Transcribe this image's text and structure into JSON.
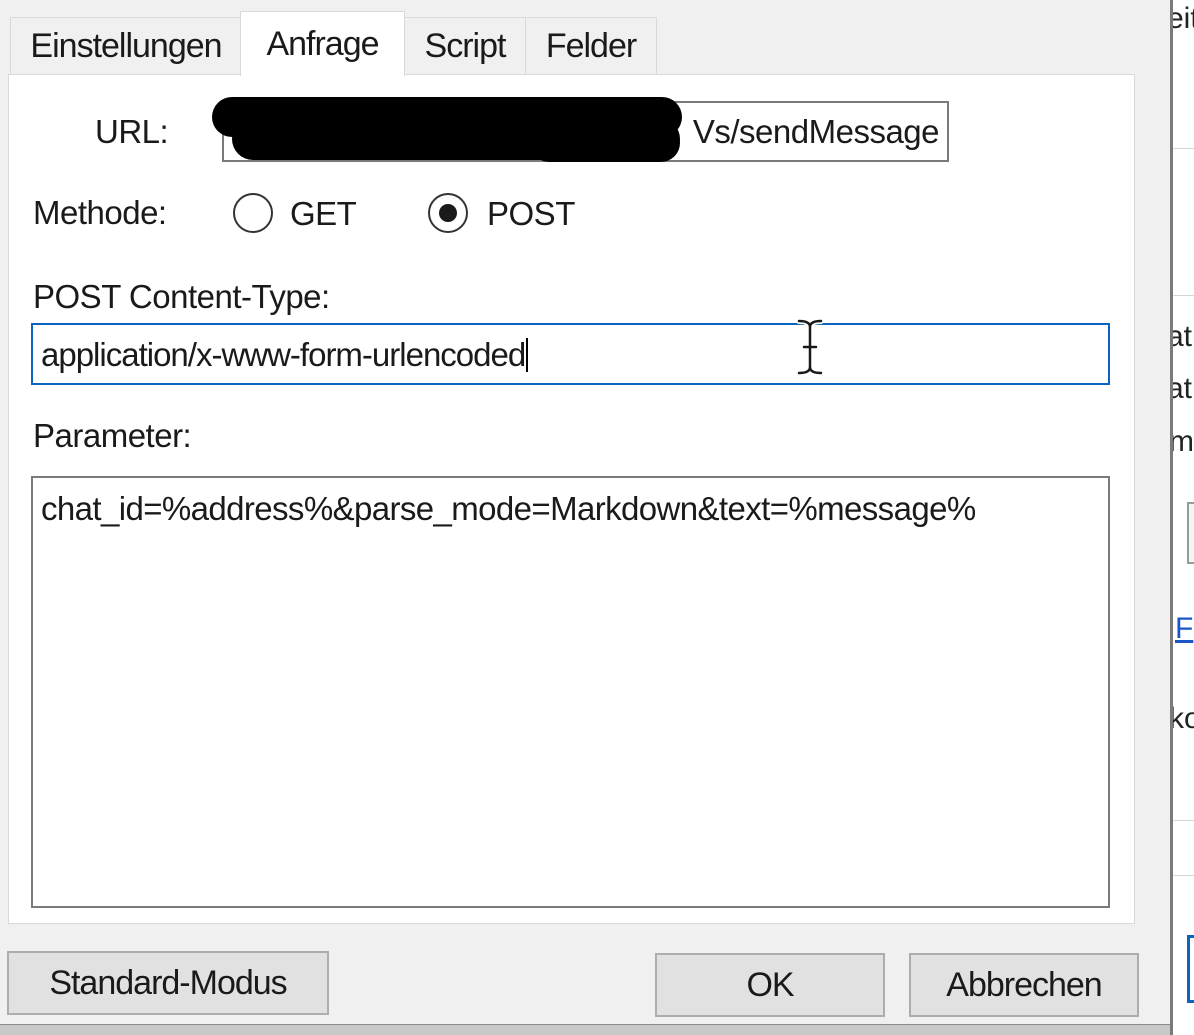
{
  "tabs": [
    {
      "label": "Einstellungen",
      "active": false
    },
    {
      "label": "Anfrage",
      "active": true
    },
    {
      "label": "Script",
      "active": false
    },
    {
      "label": "Felder",
      "active": false
    }
  ],
  "request": {
    "url_label": "URL:",
    "url_visible_value": "Vs/sendMessage",
    "method_label": "Methode:",
    "methods": [
      {
        "label": "GET",
        "selected": false
      },
      {
        "label": "POST",
        "selected": true
      }
    ],
    "content_type_label": "POST Content-Type:",
    "content_type_value": "application/x-www-form-urlencoded",
    "parameter_label": "Parameter:",
    "parameter_value": "chat_id=%address%&parse_mode=Markdown&text=%message%"
  },
  "buttons": {
    "standard_mode": "Standard-Modus",
    "ok": "OK",
    "cancel": "Abbrechen"
  },
  "background_window": {
    "fragments": [
      "eit",
      "ati",
      "ati",
      "m",
      "F",
      "ko"
    ]
  },
  "colors": {
    "focus_border": "#0b64c0",
    "window_bg": "#f0f0f0",
    "panel_bg": "#ffffff"
  }
}
